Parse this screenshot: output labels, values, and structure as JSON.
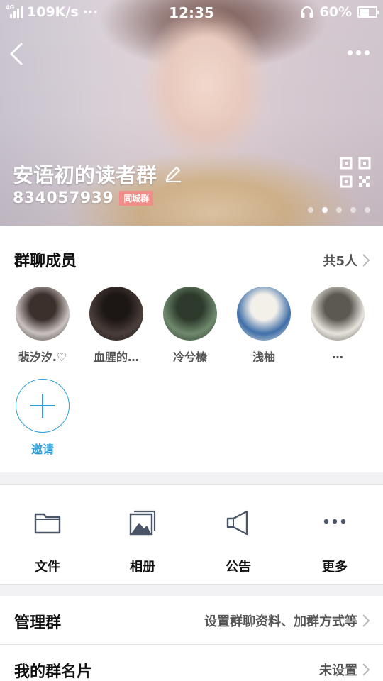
{
  "status_bar": {
    "network_type": "4G",
    "speed": "109K/s",
    "more": "···",
    "time": "12:35",
    "battery": "60%",
    "battery_level": 0.6
  },
  "header": {
    "group_name": "安语初的读者群",
    "group_id": "834057939",
    "city_badge": "同城群",
    "page_count": 5,
    "active_page": 1
  },
  "members_section": {
    "title": "群聊成员",
    "count_label": "共5人",
    "members": [
      {
        "name": "裴汐汐.♡",
        "avatar_colors": [
          "#c9c2c0",
          "#3b302c"
        ]
      },
      {
        "name": "血腥的…",
        "avatar_colors": [
          "#4a3e3a",
          "#1c1614"
        ]
      },
      {
        "name": "冷兮榛",
        "avatar_colors": [
          "#6f8a6d",
          "#2d3a2c"
        ]
      },
      {
        "name": "浅柚",
        "avatar_colors": [
          "#3f6fa8",
          "#f3f0ea"
        ]
      },
      {
        "name": "…",
        "avatar_colors": [
          "#e7e4de",
          "#5c5852"
        ]
      }
    ],
    "invite_label": "邀请"
  },
  "functions": [
    {
      "label": "文件",
      "icon": "folder-icon"
    },
    {
      "label": "相册",
      "icon": "album-icon"
    },
    {
      "label": "公告",
      "icon": "megaphone-icon"
    },
    {
      "label": "更多",
      "icon": "more-dots-icon"
    }
  ],
  "manage_row": {
    "title": "管理群",
    "hint": "设置群聊资料、加群方式等"
  },
  "card_row": {
    "title": "我的群名片",
    "hint": "未设置"
  },
  "colors": {
    "accent": "#2a9fd8",
    "badge": "#f08d88",
    "icon_gray": "#4a5668"
  }
}
